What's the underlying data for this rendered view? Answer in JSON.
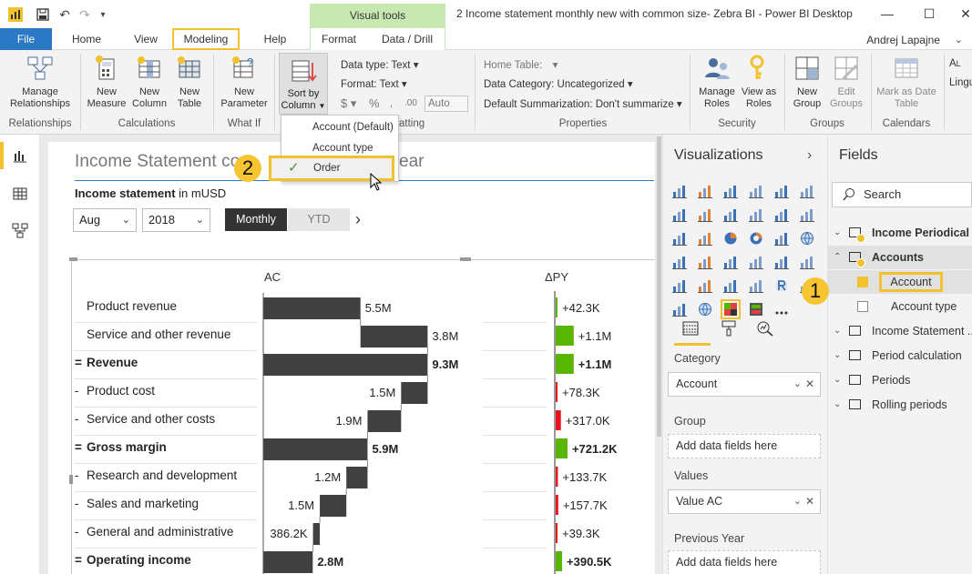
{
  "window": {
    "title": "2 Income statement monthly new with common size- Zebra BI - Power BI Desktop",
    "contextual_group": "Visual tools",
    "user": "Andrej Lapajne"
  },
  "tabs": {
    "file": "File",
    "home": "Home",
    "view": "View",
    "modeling": "Modeling",
    "help": "Help",
    "format": "Format",
    "data_drill": "Data / Drill"
  },
  "ribbon": {
    "manage_relationships": "Manage Relationships",
    "grp_relationships": "Relationships",
    "new_measure": "New Measure",
    "new_column": "New Column",
    "new_table": "New Table",
    "grp_calculations": "Calculations",
    "new_parameter": "New Parameter",
    "grp_whatif": "What If",
    "sort_by_column": "Sort by Column",
    "data_type": "Data type: Text",
    "format": "Format: Text",
    "auto": "Auto",
    "grp_formatting": "atting",
    "home_table": "Home Table:",
    "data_category": "Data Category: Uncategorized",
    "default_summarization": "Default Summarization: Don't summarize",
    "grp_properties": "Properties",
    "manage_roles": "Manage Roles",
    "view_as_roles": "View as Roles",
    "grp_security": "Security",
    "new_group": "New Group",
    "edit_groups": "Edit Groups",
    "grp_groups": "Groups",
    "mark_as_date_table": "Mark as Date Table",
    "grp_calendars": "Calendars",
    "lingu": "Lingu",
    "l": "L"
  },
  "sort_menu": {
    "items": [
      "Account (Default)",
      "Account type",
      "Order"
    ],
    "checked": "Order"
  },
  "callouts": {
    "one": "1",
    "two": "2"
  },
  "report": {
    "title_start": "Income Statement co",
    "title_end": "ear",
    "subtitle_bold": "Income statement",
    "subtitle_rest": " in mUSD",
    "month": "Aug",
    "year": "2018",
    "toggle_on": "Monthly",
    "toggle_off": "YTD",
    "col_ac": "AC",
    "col_dpy": "ΔPY"
  },
  "chart_data": {
    "type": "table",
    "title": "",
    "rows": [
      {
        "prefix": "",
        "label": "Product revenue",
        "ac": 5.5,
        "ac_text": "5.5M",
        "kind": "add",
        "dpy": 0.0423,
        "dpy_text": "+42.3K",
        "bold": false
      },
      {
        "prefix": "",
        "label": "Service and other revenue",
        "ac": 3.8,
        "ac_text": "3.8M",
        "kind": "add",
        "dpy": 1.1,
        "dpy_text": "+1.1M",
        "bold": false
      },
      {
        "prefix": "=",
        "label": "Revenue",
        "ac": 9.3,
        "ac_text": "9.3M",
        "kind": "total",
        "dpy": 1.1,
        "dpy_text": "+1.1M",
        "bold": true
      },
      {
        "prefix": "-",
        "label": "Product cost",
        "ac": 1.5,
        "ac_text": "1.5M",
        "kind": "sub",
        "dpy": 0.0783,
        "dpy_text": "+78.3K",
        "bold": false
      },
      {
        "prefix": "-",
        "label": "Service and other costs",
        "ac": 1.9,
        "ac_text": "1.9M",
        "kind": "sub",
        "dpy": 0.317,
        "dpy_text": "+317.0K",
        "bold": false
      },
      {
        "prefix": "=",
        "label": "Gross margin",
        "ac": 5.9,
        "ac_text": "5.9M",
        "kind": "total",
        "dpy": 0.7212,
        "dpy_text": "+721.2K",
        "bold": true
      },
      {
        "prefix": "-",
        "label": "Research and development",
        "ac": 1.2,
        "ac_text": "1.2M",
        "kind": "sub",
        "dpy": 0.1337,
        "dpy_text": "+133.7K",
        "bold": false
      },
      {
        "prefix": "-",
        "label": "Sales and marketing",
        "ac": 1.5,
        "ac_text": "1.5M",
        "kind": "sub",
        "dpy": 0.1577,
        "dpy_text": "+157.7K",
        "bold": false
      },
      {
        "prefix": "-",
        "label": "General and administrative",
        "ac": 0.3862,
        "ac_text": "386.2K",
        "kind": "sub",
        "dpy": 0.0393,
        "dpy_text": "+39.3K",
        "bold": false
      },
      {
        "prefix": "=",
        "label": "Operating income",
        "ac": 2.8,
        "ac_text": "2.8M",
        "kind": "total",
        "dpy": 0.3905,
        "dpy_text": "+390.5K",
        "bold": true
      }
    ],
    "colors": {
      "bar": "#404040",
      "positive": "#5ab500",
      "negative": "#e8141c"
    }
  },
  "visualizations": {
    "title": "Visualizations",
    "wells": {
      "category_title": "Category",
      "category_value": "Account",
      "group_title": "Group",
      "group_placeholder": "Add data fields here",
      "values_title": "Values",
      "values_value": "Value AC",
      "prev_title": "Previous Year",
      "prev_placeholder": "Add data fields here"
    }
  },
  "fields": {
    "title": "Fields",
    "search_placeholder": "Search",
    "tables": [
      {
        "name": "Income Periodical",
        "expanded": false,
        "bold": true
      },
      {
        "name": "Accounts",
        "expanded": true,
        "bold": true
      },
      {
        "name": "Income Statement ...",
        "expanded": false,
        "bold": false
      },
      {
        "name": "Period calculation",
        "expanded": false,
        "bold": false
      },
      {
        "name": "Periods",
        "expanded": false,
        "bold": false
      },
      {
        "name": "Rolling periods",
        "expanded": false,
        "bold": false
      }
    ],
    "account_fields": [
      "Account",
      "Account type"
    ]
  }
}
